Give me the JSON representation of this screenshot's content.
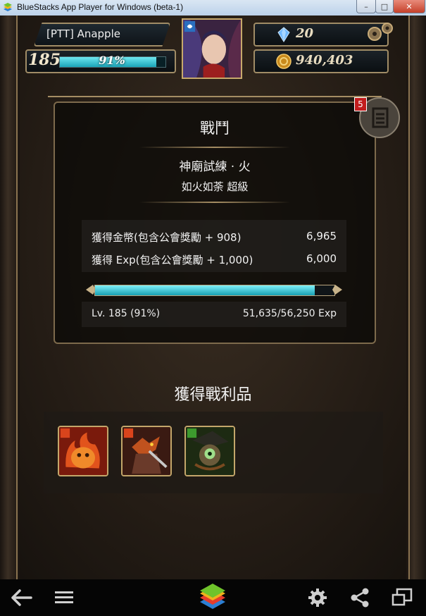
{
  "window": {
    "title": "BlueStacks App Player for Windows (beta-1)",
    "controls": [
      "minimize",
      "maximize",
      "close"
    ]
  },
  "hud": {
    "player_name": "[PTT] Anapple",
    "level": "185",
    "level_progress_label": "91%",
    "level_progress": 0.91,
    "gems": "20",
    "coins": "940,403",
    "icons": [
      "gem-icon",
      "coin-icon",
      "settings-gear-icon"
    ]
  },
  "battle": {
    "title": "戰鬥",
    "stage": "神廟試練 · 火",
    "difficulty": "如火如荼 超級",
    "rewards": [
      {
        "label": "獲得金幣(包含公會獎勵 + 908)",
        "value": "6,965"
      },
      {
        "label": "獲得 Exp(包含公會獎勵 + 1,000)",
        "value": "6,000"
      }
    ],
    "exp_progress": 0.918,
    "level_text": "Lv. 185 (91%)",
    "exp_text": "51,635/56,250 Exp",
    "notification_count": "5"
  },
  "loot": {
    "title": "獲得戰利品",
    "items": [
      {
        "name": "fire-slime-card",
        "element": "fire"
      },
      {
        "name": "fire-wolf-warrior-card",
        "element": "fire"
      },
      {
        "name": "wood-monster-card",
        "element": "wood"
      }
    ]
  },
  "navbar": {
    "icons": [
      "back-arrow-icon",
      "menu-icon",
      "bluestacks-logo-icon",
      "settings-icon",
      "share-icon",
      "screen-rotate-icon"
    ]
  },
  "colors": {
    "accent_cyan": "#1aa4b8",
    "gold_border": "#a08c66",
    "fire": "#d9441c",
    "wood": "#3d9a2e"
  }
}
